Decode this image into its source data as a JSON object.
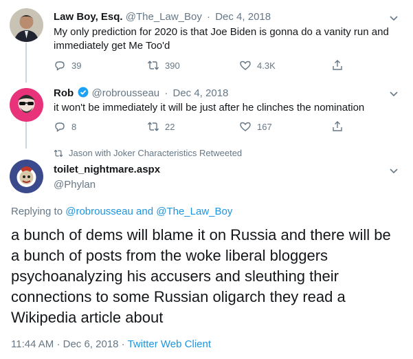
{
  "tweets": [
    {
      "name": "Law Boy, Esq.",
      "handle": "@The_Law_Boy",
      "date": "Dec 4, 2018",
      "text": "My only prediction for 2020 is that Joe Biden is gonna do a vanity run and immediately get Me Too'd",
      "replies": "39",
      "retweets": "390",
      "likes": "4.3K"
    },
    {
      "name": "Rob",
      "handle": "@robrousseau",
      "date": "Dec 4, 2018",
      "text": "it won't be immediately it will be just after he clinches the nomination",
      "replies": "8",
      "retweets": "22",
      "likes": "167"
    }
  ],
  "retweeted_label": "Jason with Joker Characteristics Retweeted",
  "main": {
    "name": "toilet_nightmare.aspx",
    "handle": "@Phylan",
    "replying_prefix": "Replying to",
    "replying_user1": "@robrousseau",
    "replying_and": "and",
    "replying_user2": "@The_Law_Boy",
    "text": "a bunch of dems will blame it on Russia and there will be a bunch of posts from the woke liberal bloggers psychoanalyzing his accusers and sleuthing their connections to some Russian oligarch they read a Wikipedia article about",
    "time": "11:44 AM",
    "date": "Dec 6, 2018",
    "client": "Twitter Web Client"
  },
  "colors": {
    "accent": "#1b95e0",
    "muted": "#657786",
    "verified": "#1da1f2",
    "thread_line": "#ccd6dd"
  }
}
